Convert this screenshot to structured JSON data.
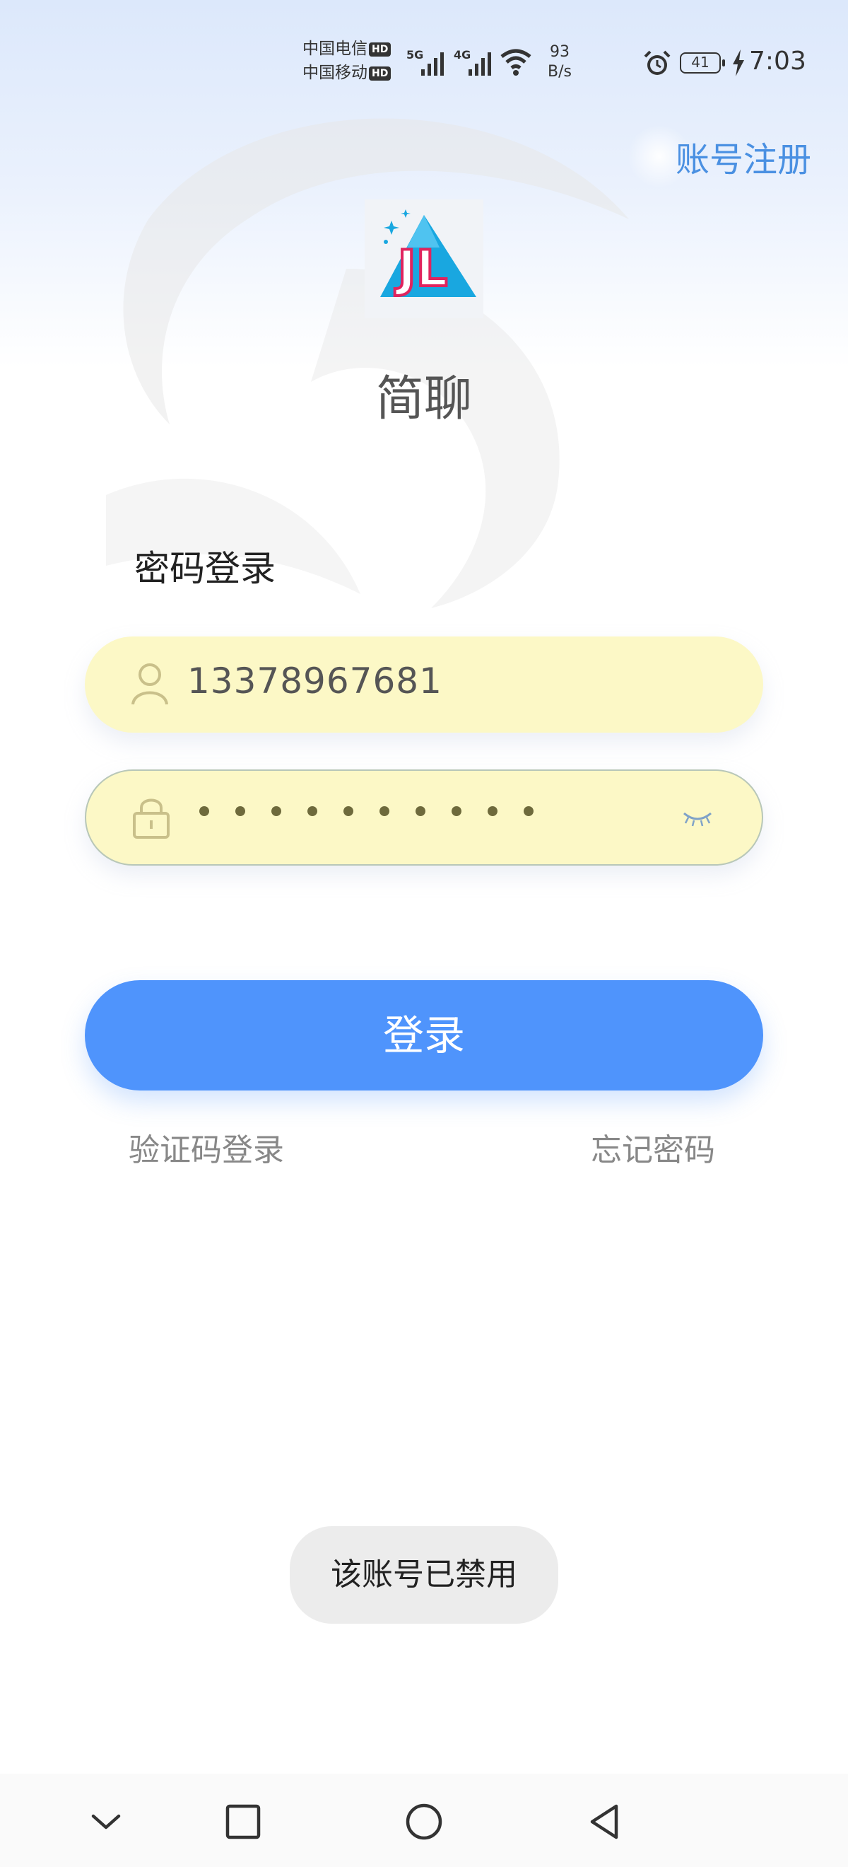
{
  "status_bar": {
    "carrier1": "中国电信",
    "carrier2": "中国移动",
    "hd_label": "HD",
    "net1": "5G",
    "net2": "4G",
    "speed_value": "93",
    "speed_unit": "B/s",
    "battery": "41",
    "time": "7:03"
  },
  "header": {
    "register_label": "账号注册"
  },
  "app": {
    "name": "简聊",
    "logo_text": "JL"
  },
  "form": {
    "title": "密码登录",
    "phone_value": "13378967681",
    "password_dot_count": 10,
    "login_label": "登录",
    "sms_login_label": "验证码登录",
    "forgot_label": "忘记密码"
  },
  "toast": {
    "message": "该账号已禁用"
  },
  "colors": {
    "accent": "#4f94fc",
    "link": "#4a90e2",
    "field_bg": "#fcf8c6"
  },
  "icons": [
    "alarm-icon",
    "battery-icon",
    "charging-icon",
    "wifi-icon",
    "signal-icon",
    "user-icon",
    "lock-icon",
    "eye-closed-icon",
    "nav-down-icon",
    "nav-recents-icon",
    "nav-home-icon",
    "nav-back-icon"
  ]
}
